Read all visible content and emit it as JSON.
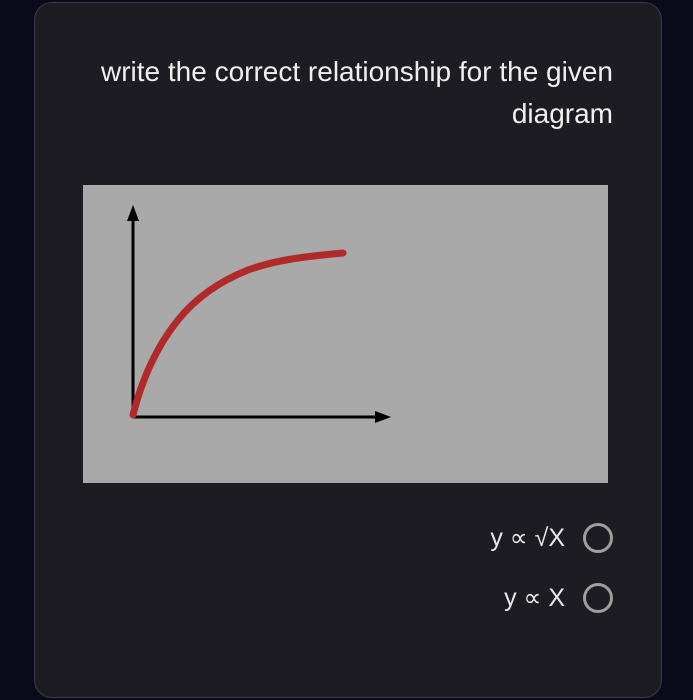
{
  "question": {
    "prompt": "write the correct relationship for the given diagram"
  },
  "chart_data": {
    "type": "line",
    "title": "",
    "xlabel": "",
    "ylabel": "",
    "description": "unlabeled axes with a concave-down increasing curve resembling y proportional to sqrt(x)",
    "x": [
      0,
      0.05,
      0.1,
      0.2,
      0.3,
      0.4,
      0.5,
      0.6,
      0.7,
      0.8,
      0.9,
      1.0
    ],
    "y": [
      0,
      0.22,
      0.32,
      0.45,
      0.55,
      0.63,
      0.71,
      0.77,
      0.84,
      0.89,
      0.95,
      1.0
    ],
    "xlim": [
      0,
      1
    ],
    "ylim": [
      0,
      1
    ]
  },
  "options": [
    {
      "label": "y ∝ √X",
      "selected": false
    },
    {
      "label": "y ∝ X",
      "selected": false
    }
  ]
}
